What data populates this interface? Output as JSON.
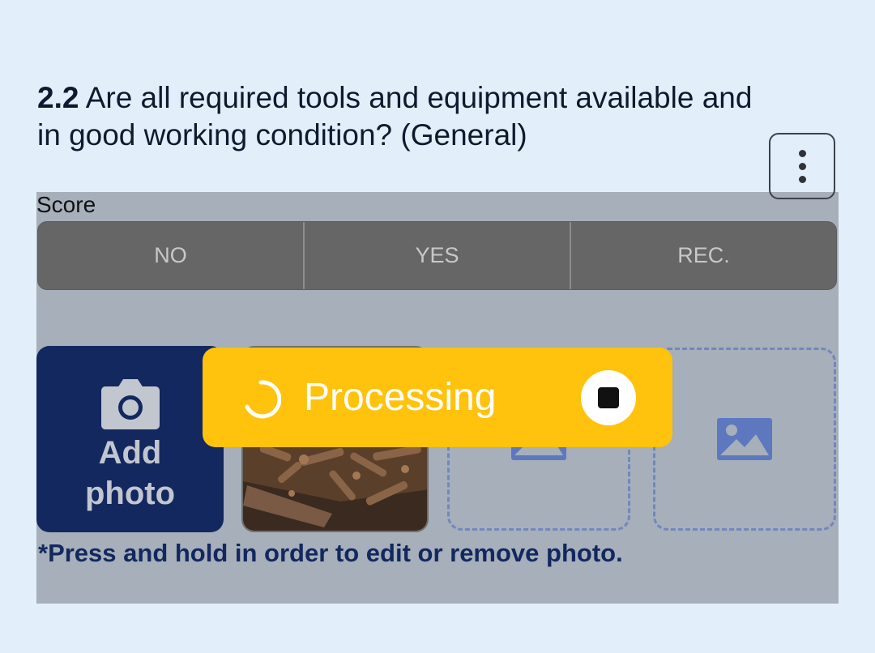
{
  "question": {
    "number": "2.2",
    "text": "Are all required tools and equipment available and in good working condition? (General)"
  },
  "menu": {
    "icon": "more-vertical-icon"
  },
  "score": {
    "label": "Score",
    "options": [
      "NO",
      "YES",
      "REC."
    ]
  },
  "photos": {
    "add_label": "Add photo",
    "add_icon": "camera-icon",
    "empty_slot_icon": "image-icon",
    "hint": "*Press and hold in order to edit or remove photo."
  },
  "toast": {
    "text": "Processing",
    "spinner_icon": "spinner-icon",
    "stop_icon": "stop-icon"
  },
  "colors": {
    "background": "#e2effb",
    "overlay": "#a6afba",
    "primary": "#13285f",
    "toast": "#ffc20d",
    "segment": "#666666"
  }
}
